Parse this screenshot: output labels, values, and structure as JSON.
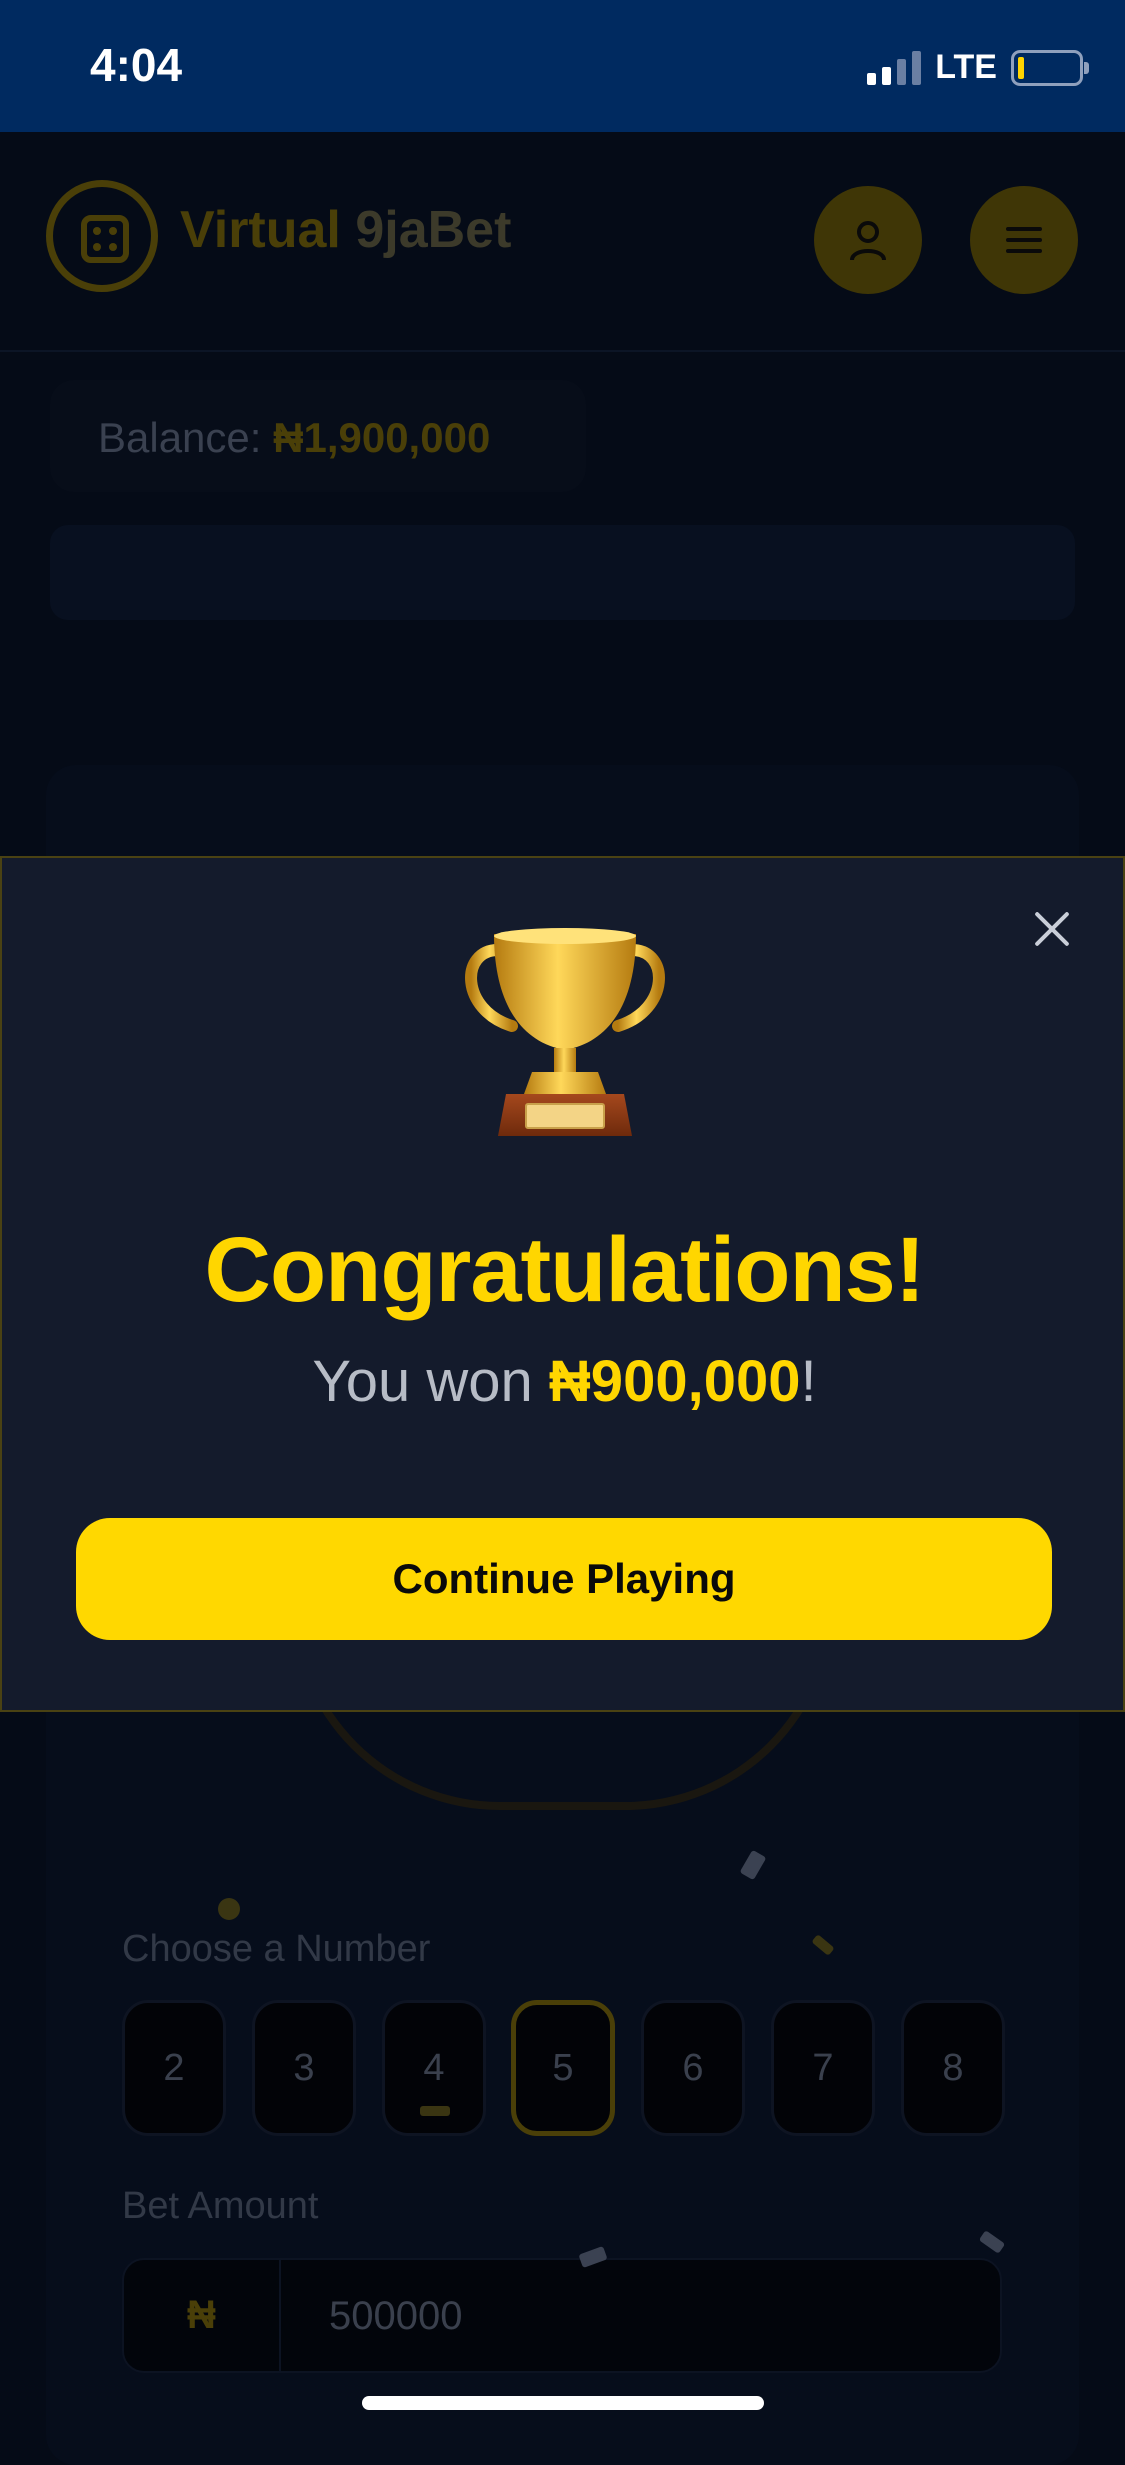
{
  "status_bar": {
    "time": "4:04",
    "network": "LTE"
  },
  "header": {
    "brand_part1": "Virtual",
    "brand_part2": "9jaBet",
    "icons": [
      "dice-icon",
      "user-icon",
      "menu-icon"
    ]
  },
  "balance": {
    "label": "Balance:",
    "value": "₦1,900,000"
  },
  "game": {
    "choose_label": "Choose a Number",
    "numbers": [
      "2",
      "3",
      "4",
      "5",
      "6",
      "7",
      "8"
    ],
    "selected_number": "5",
    "bet_label": "Bet Amount",
    "currency": "₦",
    "bet_value": "500000"
  },
  "modal": {
    "icon": "trophy-icon",
    "title": "Congratulations!",
    "message_prefix": "You won ",
    "amount": "₦900,000",
    "message_suffix": "!",
    "button_label": "Continue Playing"
  },
  "colors": {
    "accent": "#ffd600",
    "status_bar": "#002a60",
    "modal_bg": "#141b2c"
  }
}
